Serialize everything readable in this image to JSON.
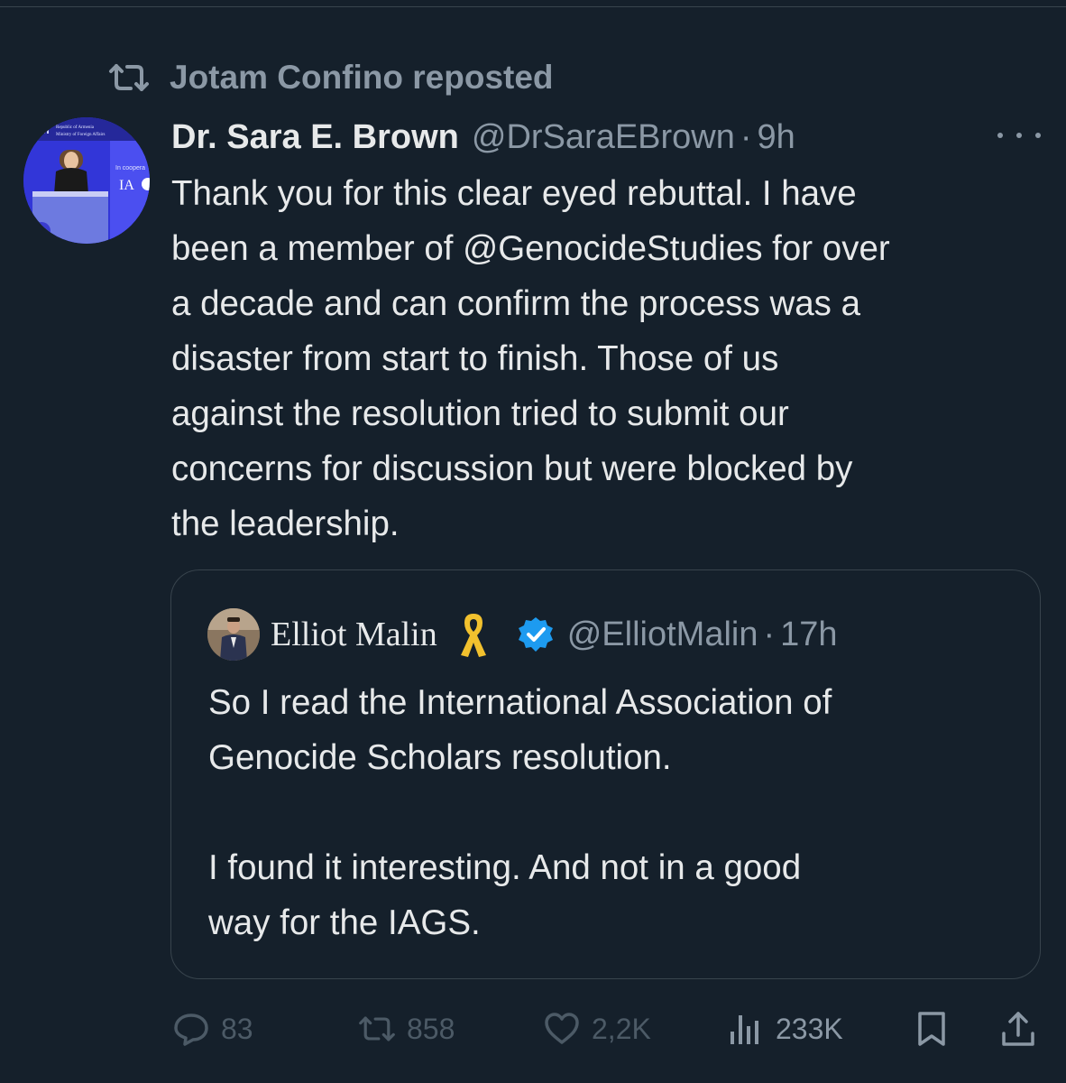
{
  "repost": {
    "text": "Jotam Confino reposted",
    "icon": "repost-icon"
  },
  "tweet": {
    "display_name": "Dr. Sara E. Brown",
    "handle": "@DrSaraEBrown",
    "separator": "·",
    "time": "9h",
    "text_lines": [
      "Thank you for this clear eyed rebuttal. I have",
      "been a member of @GenocideStudies for over",
      "a decade and can confirm the process was a",
      "disaster from start to finish. Those of us",
      "against the resolution tried to submit our",
      "concerns for discussion but were blocked by",
      "the leadership."
    ],
    "avatar_lettering": [
      "Republic of Armenia",
      "Ministry of Foreign Affairs",
      "In coopera",
      "IA"
    ]
  },
  "quote": {
    "display_name": "Elliot Malin",
    "handle": "@ElliotMalin",
    "separator": "·",
    "time": "17h",
    "ribbon_icon": "yellow-ribbon-icon",
    "verified_icon": "verified-badge-icon",
    "verified_color": "#1d9bf0",
    "ribbon_color": "#f2c12e",
    "paragraph1_lines": [
      "So I read the International Association of",
      "Genocide Scholars resolution."
    ],
    "paragraph2_lines": [
      "I found it interesting. And not in a good",
      "way for the IAGS."
    ]
  },
  "actions": {
    "replies": "83",
    "reposts": "858",
    "likes": "2,2K",
    "views": "233K",
    "icons": [
      "reply-icon",
      "repost-icon",
      "like-icon",
      "views-icon",
      "bookmark-icon",
      "share-icon"
    ]
  },
  "colors": {
    "background": "#15202b",
    "text": "#e7e9ea",
    "secondary": "#8b98a5",
    "dimmed": "#4c5a66",
    "border": "#38444d"
  }
}
